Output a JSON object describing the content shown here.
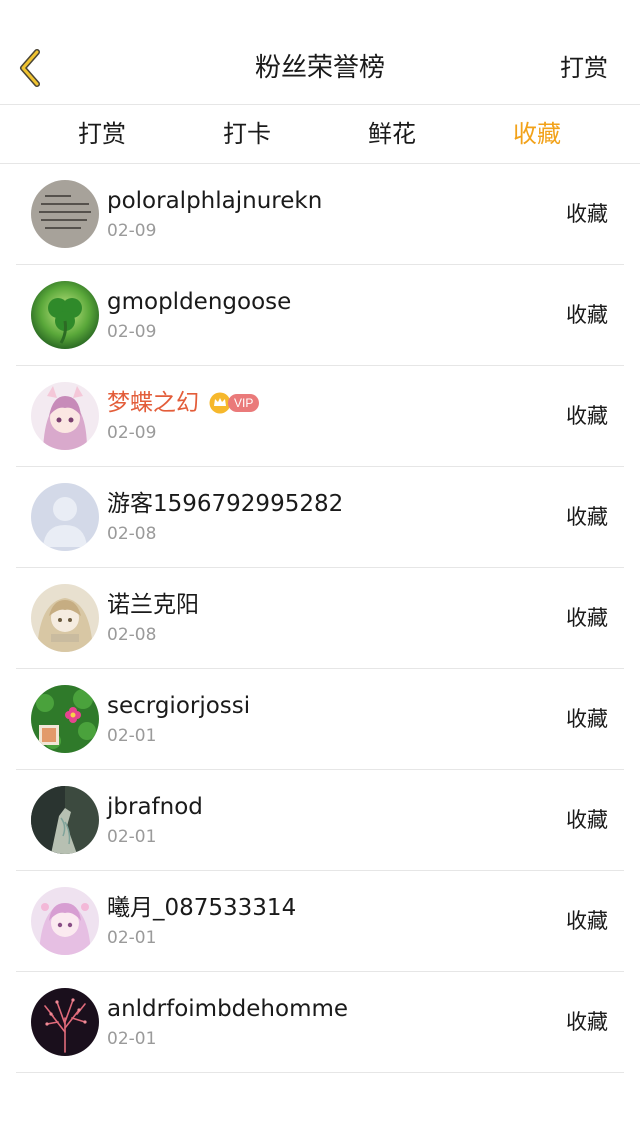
{
  "header": {
    "title": "粉丝荣誉榜",
    "right_action": "打赏"
  },
  "tabs": [
    {
      "label": "打赏",
      "active": false
    },
    {
      "label": "打卡",
      "active": false
    },
    {
      "label": "鲜花",
      "active": false
    },
    {
      "label": "收藏",
      "active": true
    }
  ],
  "colors": {
    "accent": "#f2a21a",
    "vip_name": "#e35d3a",
    "muted": "#9a9a9a"
  },
  "fans": [
    {
      "name": "poloralphlajnurekn",
      "date": "02-09",
      "action": "收藏",
      "avatar": "text-note"
    },
    {
      "name": "gmopldengoose",
      "date": "02-09",
      "action": "收藏",
      "avatar": "clover"
    },
    {
      "name": "梦蝶之幻",
      "date": "02-09",
      "action": "收藏",
      "avatar": "anime-girl",
      "vip": true,
      "vip_label": "VIP"
    },
    {
      "name": "游客1596792995282",
      "date": "02-08",
      "action": "收藏",
      "avatar": "default-user"
    },
    {
      "name": "诺兰克阳",
      "date": "02-08",
      "action": "收藏",
      "avatar": "anime-sketch"
    },
    {
      "name": "secrgiorjossi",
      "date": "02-01",
      "action": "收藏",
      "avatar": "flower-green"
    },
    {
      "name": "jbrafnod",
      "date": "02-01",
      "action": "收藏",
      "avatar": "dark-hand"
    },
    {
      "name": "曦月_087533314",
      "date": "02-01",
      "action": "收藏",
      "avatar": "anime-pink"
    },
    {
      "name": "anldrfoimbdehomme",
      "date": "02-01",
      "action": "收藏",
      "avatar": "coral-dark"
    }
  ]
}
